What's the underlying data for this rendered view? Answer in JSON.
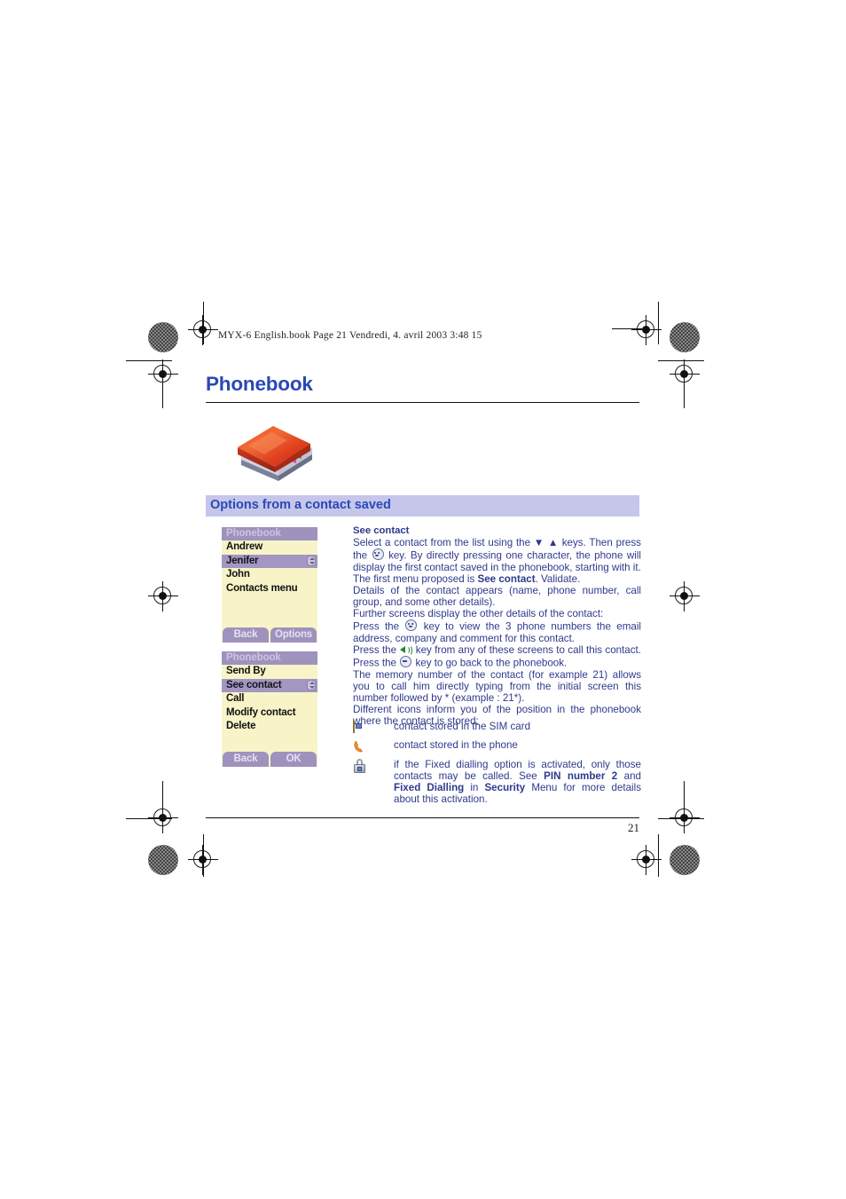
{
  "book_header": "MYX-6 English.book  Page 21  Vendredi, 4. avril 2003  3:48 15",
  "page_title": "Phonebook",
  "section": {
    "heading": "Options from a contact saved"
  },
  "footer": {
    "page_number": "21"
  },
  "colors": {
    "heading_blue": "#2a48b5",
    "body_blue": "#2d3a8c",
    "band_lavender": "#c5c6ea",
    "screen_bg": "#f8f4c8",
    "screen_title_bar": "#9f92bd",
    "screen_selected": "#a396c0",
    "softkey": "#9f92bd"
  },
  "phone_screens": [
    {
      "title": "Phonebook",
      "items": [
        {
          "label": "Andrew",
          "selected": false
        },
        {
          "label": "Jenifer",
          "selected": true
        },
        {
          "label": "John",
          "selected": false
        },
        {
          "label": "Contacts menu",
          "selected": false
        }
      ],
      "softkeys": {
        "left": "Back",
        "right": "Options"
      }
    },
    {
      "title": "Phonebook",
      "items": [
        {
          "label": "Send By",
          "selected": false
        },
        {
          "label": "See contact",
          "selected": true
        },
        {
          "label": "Call",
          "selected": false
        },
        {
          "label": "Modify contact",
          "selected": false
        },
        {
          "label": "Delete",
          "selected": false
        }
      ],
      "softkeys": {
        "left": "Back",
        "right": "OK"
      }
    }
  ],
  "body": {
    "subheading": "See contact",
    "p1_a": "Select a contact from the list using the",
    "p1_b": "keys. Then press the",
    "p1_c": "key. By directly pressing one character, the phone will display the first contact saved in the phonebook, starting with it.",
    "p2_a": "The first menu proposed is",
    "p2_bold": "See contact",
    "p2_b": ". Validate.",
    "p3": "Details of the contact appears (name, phone number, call group, and some other details).",
    "p4": "Further screens display the other details of the contact:",
    "p5_a": "Press the",
    "p5_b": "key to view the 3 phone numbers the email address, company and comment for this contact.",
    "p6_a": "Press the",
    "p6_b": "key from any of these screens to call this contact. Press the",
    "p6_c": "key to go back to the phonebook.",
    "p7": "The memory number of the contact (for example 21) allows you to call him directly typing from the initial screen this number followed by * (example : 21*).",
    "p8": "Different icons inform you of the position in the phonebook where the contact is stored:"
  },
  "legend": [
    {
      "icon": "sim-card-icon",
      "text": "contact stored in the SIM card"
    },
    {
      "icon": "phone-handset-icon",
      "text": "contact stored in the phone"
    },
    {
      "icon": "padlock-icon",
      "text_a": "if the Fixed dialling option is activated, only those contacts may be called. See",
      "bold_1": "PIN number 2",
      "text_b": "and",
      "bold_2": "Fixed Dialling",
      "text_c": "in",
      "bold_3": "Security",
      "text_d": "Menu for more details about this activation."
    }
  ]
}
